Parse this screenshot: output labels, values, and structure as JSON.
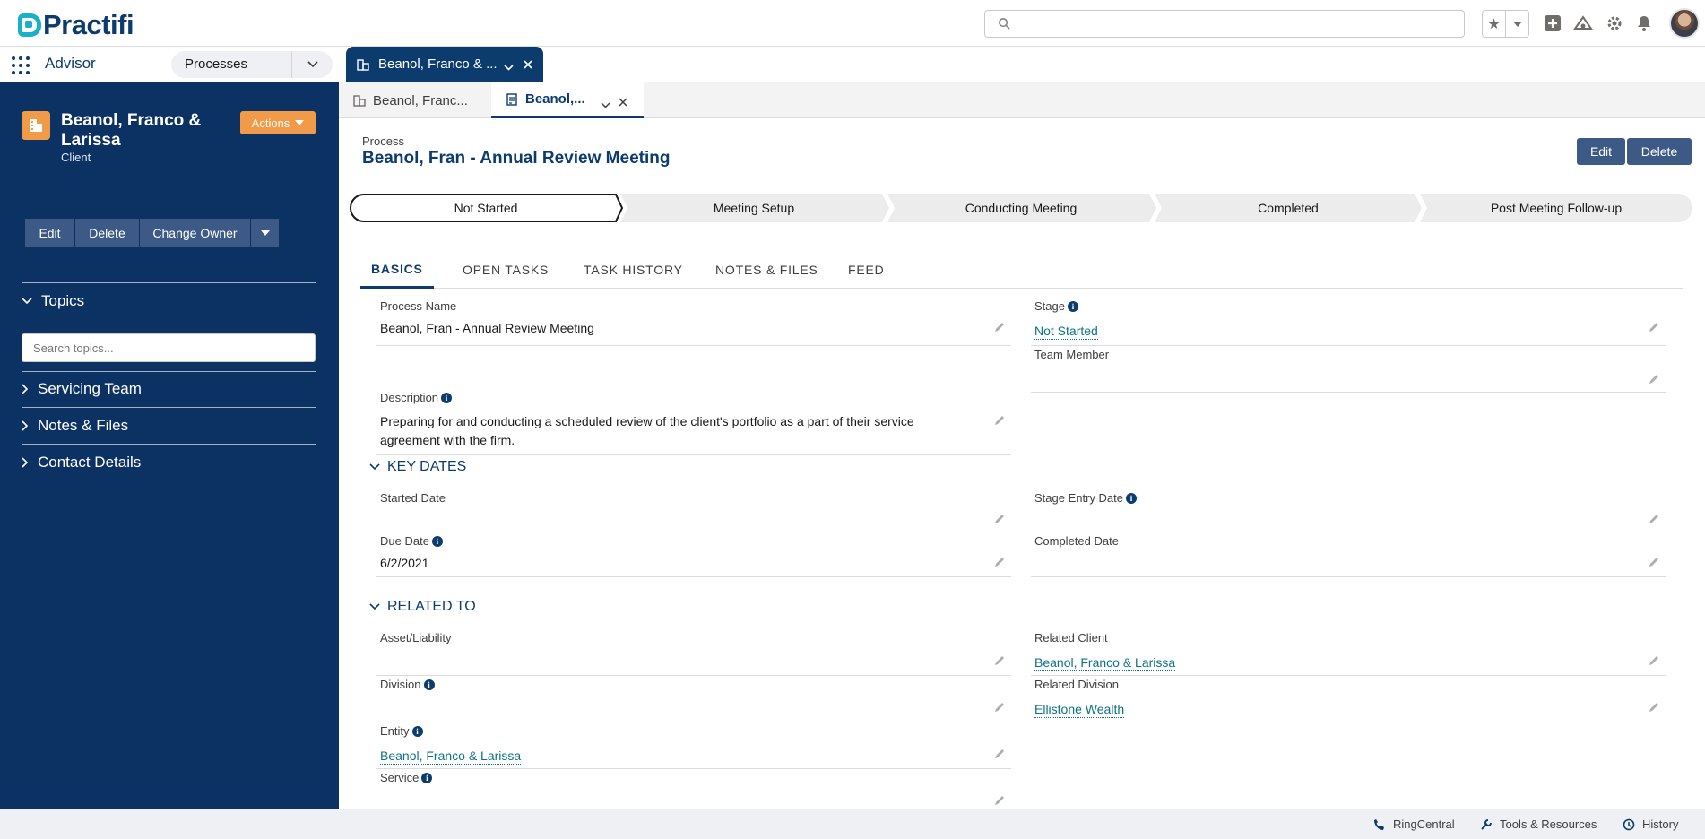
{
  "header": {
    "logo_text": "Practifi"
  },
  "app_nav": {
    "app_name": "Advisor",
    "object_select": "Processes",
    "workspace_tab": "Beanol, Franco & ..."
  },
  "subtabs": [
    {
      "label": "Beanol, Franc..."
    },
    {
      "label": "Beanol,..."
    }
  ],
  "sidebar": {
    "account_name": "Beanol, Franco & Larissa",
    "account_type": "Client",
    "actions_label": "Actions",
    "buttons": {
      "edit": "Edit",
      "delete": "Delete",
      "change_owner": "Change Owner"
    },
    "topics_label": "Topics",
    "topics_placeholder": "Search topics...",
    "sections": [
      "Servicing Team",
      "Notes & Files",
      "Contact Details"
    ]
  },
  "record": {
    "type_label": "Process",
    "title": "Beanol, Fran - Annual Review Meeting",
    "buttons": {
      "edit": "Edit",
      "delete": "Delete"
    },
    "path": [
      "Not Started",
      "Meeting Setup",
      "Conducting Meeting",
      "Completed",
      "Post Meeting Follow-up"
    ],
    "current_stage_index": 0,
    "tabs": [
      "BASICS",
      "OPEN TASKS",
      "TASK HISTORY",
      "NOTES & FILES",
      "FEED"
    ],
    "fields": {
      "process_name": {
        "label": "Process Name",
        "value": "Beanol, Fran - Annual Review Meeting"
      },
      "stage": {
        "label": "Stage",
        "value": "Not Started"
      },
      "team_member": {
        "label": "Team Member",
        "value": ""
      },
      "description": {
        "label": "Description",
        "value": "Preparing for and conducting a scheduled review of the client's portfolio as a part of their service agreement with the firm."
      },
      "started_date": {
        "label": "Started Date",
        "value": ""
      },
      "stage_entry_date": {
        "label": "Stage Entry Date",
        "value": ""
      },
      "due_date": {
        "label": "Due Date",
        "value": "6/2/2021"
      },
      "completed_date": {
        "label": "Completed Date",
        "value": ""
      },
      "asset_liability": {
        "label": "Asset/Liability",
        "value": ""
      },
      "related_client": {
        "label": "Related Client",
        "value": "Beanol, Franco & Larissa"
      },
      "division": {
        "label": "Division",
        "value": ""
      },
      "related_division": {
        "label": "Related Division",
        "value": "Ellistone Wealth"
      },
      "entity": {
        "label": "Entity",
        "value": "Beanol, Franco & Larissa"
      },
      "service": {
        "label": "Service",
        "value": ""
      }
    },
    "sections": {
      "key_dates": "KEY DATES",
      "related_to": "RELATED TO"
    }
  },
  "utility_bar": [
    "RingCentral",
    "Tools & Resources",
    "History"
  ],
  "colors": {
    "brand_navy": "#0c3163",
    "accent_orange": "#f19a47",
    "link_teal": "#0b7285"
  }
}
